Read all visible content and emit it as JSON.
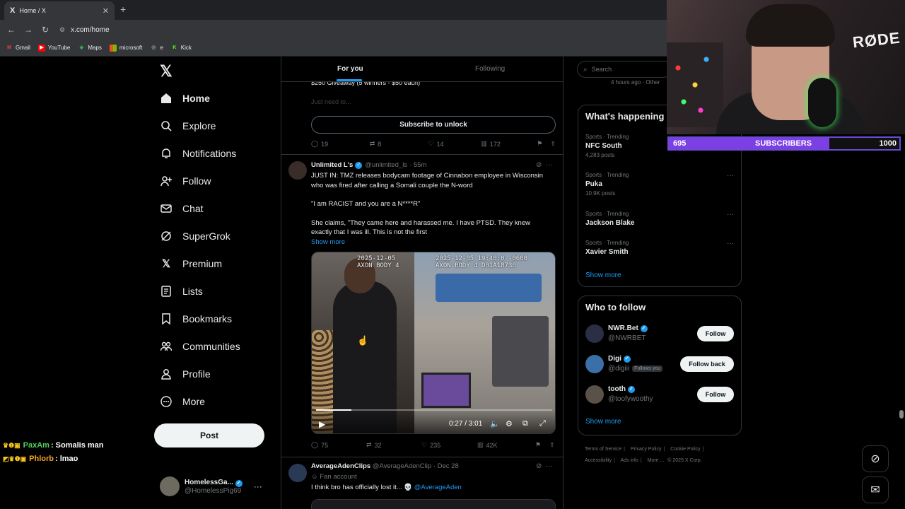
{
  "browser": {
    "tab_title": "Home / X",
    "tab_favicon": "X",
    "url": "x.com/home",
    "bookmarks": [
      {
        "label": "Gmail",
        "icon": "gmail-icon",
        "color": "#ea4335"
      },
      {
        "label": "YouTube",
        "icon": "youtube-icon",
        "color": "#ff0000"
      },
      {
        "label": "Maps",
        "icon": "maps-icon",
        "color": "#34a853"
      },
      {
        "label": "microsoft",
        "icon": "microsoft-icon",
        "color": "#f25022"
      },
      {
        "label": "e",
        "icon": "globe-icon",
        "color": "#9aa0a6"
      },
      {
        "label": "Kick",
        "icon": "kick-icon",
        "color": "#53fc18"
      }
    ]
  },
  "nav": {
    "items": [
      {
        "label": "Home",
        "icon": "home-icon"
      },
      {
        "label": "Explore",
        "icon": "search-icon"
      },
      {
        "label": "Notifications",
        "icon": "bell-icon"
      },
      {
        "label": "Follow",
        "icon": "add-person-icon"
      },
      {
        "label": "Chat",
        "icon": "mail-icon"
      },
      {
        "label": "SuperGrok",
        "icon": "grok-icon"
      },
      {
        "label": "Premium",
        "icon": "x-icon"
      },
      {
        "label": "Lists",
        "icon": "list-icon"
      },
      {
        "label": "Bookmarks",
        "icon": "bookmark-icon"
      },
      {
        "label": "Communities",
        "icon": "people-icon"
      },
      {
        "label": "Profile",
        "icon": "person-icon"
      },
      {
        "label": "More",
        "icon": "more-circle-icon"
      }
    ],
    "post_label": "Post",
    "account": {
      "name": "HomelessGa...",
      "handle": "@HomelessPig69"
    }
  },
  "feed": {
    "tabs": {
      "for_you": "For you",
      "following": "Following"
    },
    "post1": {
      "text": "$250 Giveaway (5 winners - $50 each)",
      "sub": "Just need to...",
      "subscribe": "Subscribe to unlock",
      "replies": "19",
      "reposts": "8",
      "likes": "14",
      "views": "172"
    },
    "post2": {
      "name": "Unlimited L's",
      "handle": "@unlimited_ls",
      "time": "· 55m",
      "line1": "JUST IN: TMZ releases bodycam footage of Cinnabon employee in Wisconsin who was fired after calling a Somali couple the N-word",
      "line2": "\"I am RACIST and you are a N****R\"",
      "line3": "She claims, \"They came here and harassed me. I have PTSD. They knew exactly that I was ill. This is not the first",
      "show_more": "Show more",
      "video_ts_left": "2025-12-05\nAXON BODY 4",
      "video_ts_right": "2025-12-05 19:40:0 -0600\nAXON BODY 4 D01A18736",
      "video_time": "0:27 / 3:01",
      "video_progress": 0.15,
      "replies": "75",
      "reposts": "32",
      "likes": "235",
      "views": "42K"
    },
    "post3": {
      "name": "AverageAdenClips",
      "handle": "@AverageAdenClip",
      "time": "· Dec 28",
      "fan": "Fan account",
      "text": "I think bro has officially lost it... 💀",
      "mention": "@AverageAden"
    }
  },
  "right": {
    "search_placeholder": "Search",
    "top_snippet": "4 hours ago · Other",
    "whats_happening": "What's happening",
    "trends": [
      {
        "cat": "Sports · Trending",
        "name": "NFC South",
        "count": "4,283 posts"
      },
      {
        "cat": "Sports · Trending",
        "name": "Puka",
        "count": "10.9K posts"
      },
      {
        "cat": "Sports · Trending",
        "name": "Jackson Blake",
        "count": ""
      },
      {
        "cat": "Sports · Trending",
        "name": "Xavier Smith",
        "count": ""
      }
    ],
    "show_more": "Show more",
    "who_to_follow": "Who to follow",
    "follow_suggestions": [
      {
        "name": "NWR.Bet",
        "handle": "@NWRBET",
        "button": "Follow",
        "color": "#2a2f45"
      },
      {
        "name": "Digi",
        "handle": "@digiii",
        "button": "Follow back",
        "follows_you": "Follows you",
        "color": "#3b6fa8"
      },
      {
        "name": "tooth",
        "handle": "@toofywoothy",
        "button": "Follow",
        "color": "#5a5248"
      }
    ],
    "show_more2": "Show more",
    "footer": [
      "Terms of Service",
      "Privacy Policy",
      "Cookie Policy",
      "Accessibility",
      "Ads info",
      "More ...",
      "© 2025 X Corp."
    ]
  },
  "overlay": {
    "mic_brand": "RØDE",
    "sub_current": "695",
    "sub_label": "SUBSCRIBERS",
    "sub_goal": "1000",
    "sub_fraction": 0.695,
    "chat": [
      {
        "user": "PaxAm",
        "color": "#52d15e",
        "msg": ": Somalis man"
      },
      {
        "user": "Phlorb",
        "color": "#f5a623",
        "msg": ": lmao"
      }
    ]
  }
}
